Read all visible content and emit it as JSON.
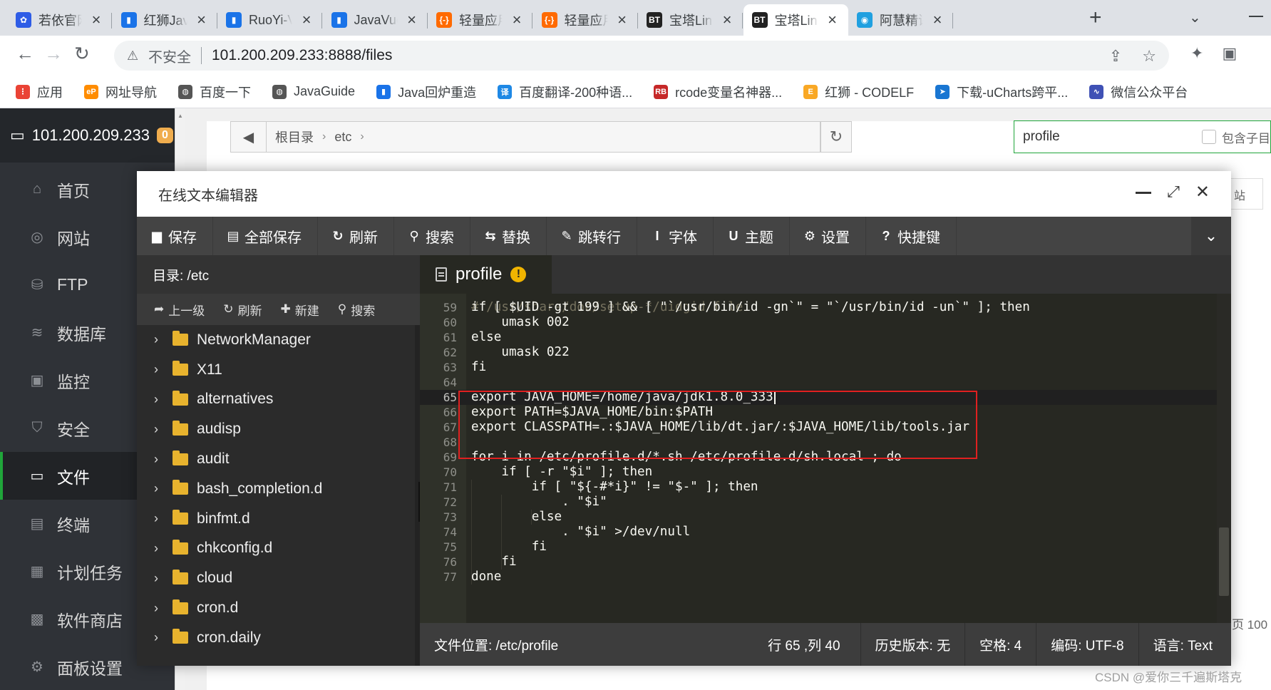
{
  "browser": {
    "tabs": [
      {
        "title": "若依官网",
        "favicon_color": "#2e5ce6",
        "favicon": "✿"
      },
      {
        "title": "红狮Java",
        "favicon_color": "#1a73e8",
        "favicon": "▮"
      },
      {
        "title": "RuoYi-V",
        "favicon_color": "#1a73e8",
        "favicon": "▮"
      },
      {
        "title": "JavaVue",
        "favicon_color": "#1a73e8",
        "favicon": "▮"
      },
      {
        "title": "轻量应用",
        "favicon_color": "#ff6a00",
        "favicon": "{-}"
      },
      {
        "title": "轻量应用",
        "favicon_color": "#ff6a00",
        "favicon": "{-}"
      },
      {
        "title": "宝塔Linu",
        "favicon_color": "#222222",
        "favicon": "BT"
      },
      {
        "title": "宝塔Linu",
        "favicon_color": "#222222",
        "favicon": "BT",
        "active": true
      },
      {
        "title": "阿慧精讲",
        "favicon_color": "#20a0e0",
        "favicon": "◉"
      }
    ],
    "insecure_label": "不安全",
    "url": "101.200.209.233:8888/files",
    "bookmarks": [
      {
        "label": "应用",
        "icon_color": "#ea4335",
        "icon": "⋮"
      },
      {
        "label": "网址导航",
        "icon_color": "#ff8c00",
        "icon": "eP"
      },
      {
        "label": "百度一下",
        "icon_color": "#555555",
        "icon": "◍"
      },
      {
        "label": "JavaGuide",
        "icon_color": "#555555",
        "icon": "◍"
      },
      {
        "label": "Java回炉重造",
        "icon_color": "#1a73e8",
        "icon": "▮"
      },
      {
        "label": "百度翻译-200种语...",
        "icon_color": "#1e88e5",
        "icon": "译"
      },
      {
        "label": "rcode变量名神器...",
        "icon_color": "#c62828",
        "icon": "RB"
      },
      {
        "label": "红狮 - CODELF",
        "icon_color": "#f9a825",
        "icon": "E"
      },
      {
        "label": "下载-uCharts跨平...",
        "icon_color": "#1976d2",
        "icon": "➤"
      },
      {
        "label": "微信公众平台",
        "icon_color": "#3f51b5",
        "icon": "∿"
      }
    ]
  },
  "panel": {
    "server_ip": "101.200.209.233",
    "badge_count": "0",
    "menu": [
      {
        "label": "首页",
        "icon": "⌂"
      },
      {
        "label": "网站",
        "icon": "◎"
      },
      {
        "label": "FTP",
        "icon": "⛁"
      },
      {
        "label": "数据库",
        "icon": "≋"
      },
      {
        "label": "监控",
        "icon": "▣"
      },
      {
        "label": "安全",
        "icon": "⛉"
      },
      {
        "label": "文件",
        "icon": "▭",
        "active": true
      },
      {
        "label": "终端",
        "icon": "▤"
      },
      {
        "label": "计划任务",
        "icon": "▦"
      },
      {
        "label": "软件商店",
        "icon": "▩"
      },
      {
        "label": "面板设置",
        "icon": "⚙"
      }
    ],
    "breadcrumb": [
      "根目录",
      "etc"
    ],
    "search_value": "profile",
    "include_subdir_label": "包含子目",
    "bg_button_text": "站",
    "bg_page_info": "页 100"
  },
  "editor": {
    "title": "在线文本编辑器",
    "toolbar": [
      {
        "label": "保存",
        "icon": "▆"
      },
      {
        "label": "全部保存",
        "icon": "▤"
      },
      {
        "label": "刷新",
        "icon": "↻"
      },
      {
        "label": "搜索",
        "icon": "⚲"
      },
      {
        "label": "替换",
        "icon": "⇆"
      },
      {
        "label": "跳转行",
        "icon": "✎"
      },
      {
        "label": "字体",
        "icon": "I"
      },
      {
        "label": "主题",
        "icon": "U"
      },
      {
        "label": "设置",
        "icon": "⚙"
      },
      {
        "label": "快捷键",
        "icon": "?"
      }
    ],
    "directory_label": "目录: /etc",
    "dir_actions": [
      {
        "label": "上一级",
        "icon": "➦"
      },
      {
        "label": "刷新",
        "icon": "↻"
      },
      {
        "label": "新建",
        "icon": "✚"
      },
      {
        "label": "搜索",
        "icon": "⚲"
      }
    ],
    "tree": [
      "NetworkManager",
      "X11",
      "alternatives",
      "audisp",
      "audit",
      "bash_completion.d",
      "binfmt.d",
      "chkconfig.d",
      "cloud",
      "cron.d",
      "cron.daily"
    ],
    "active_file": "profile",
    "modified_mark": "!",
    "partial_line": "# /usr/share/doc/setup-*/uidgid file",
    "code": [
      {
        "n": "59",
        "t": "if [ $UID -gt 199 ] && [ \"`/usr/bin/id -gn`\" = \"`/usr/bin/id -un`\" ]; then"
      },
      {
        "n": "60",
        "t": "    umask 002"
      },
      {
        "n": "61",
        "t": "else"
      },
      {
        "n": "62",
        "t": "    umask 022"
      },
      {
        "n": "63",
        "t": "fi"
      },
      {
        "n": "64",
        "t": ""
      },
      {
        "n": "65",
        "t": "export JAVA_HOME=/home/java/jdk1.8.0_333",
        "current": true
      },
      {
        "n": "66",
        "t": "export PATH=$JAVA_HOME/bin:$PATH"
      },
      {
        "n": "67",
        "t": "export CLASSPATH=.:$JAVA_HOME/lib/dt.jar/:$JAVA_HOME/lib/tools.jar"
      },
      {
        "n": "68",
        "t": ""
      },
      {
        "n": "69",
        "t": "for i in /etc/profile.d/*.sh /etc/profile.d/sh.local ; do"
      },
      {
        "n": "70",
        "t": "    if [ -r \"$i\" ]; then"
      },
      {
        "n": "71",
        "t": "        if [ \"${-#*i}\" != \"$-\" ]; then"
      },
      {
        "n": "72",
        "t": "            . \"$i\""
      },
      {
        "n": "73",
        "t": "        else"
      },
      {
        "n": "74",
        "t": "            . \"$i\" >/dev/null"
      },
      {
        "n": "75",
        "t": "        fi"
      },
      {
        "n": "76",
        "t": "    fi"
      },
      {
        "n": "77",
        "t": "done"
      }
    ],
    "status": {
      "file_location": "文件位置: /etc/profile",
      "cursor_pos": "行 65 ,列 40",
      "history": "历史版本: 无",
      "spaces": "空格: 4",
      "encoding": "编码: UTF-8",
      "language": "语言: Text"
    }
  },
  "watermark": "CSDN @爱你三千遍斯塔克",
  "colors": {
    "accent_green": "#20a53a",
    "highlight_red": "#e02020",
    "editor_bg": "#272822"
  }
}
